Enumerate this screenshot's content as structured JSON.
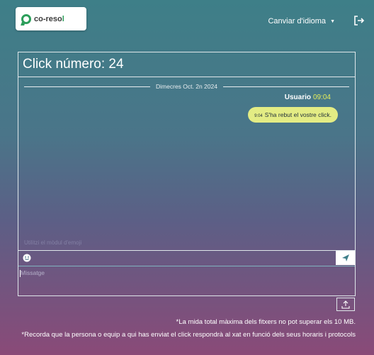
{
  "header": {
    "logo_text_prefix": "co-reso",
    "logo_text_suffix": "l",
    "language_label": "Canviar d'idioma",
    "language_caret": "▼"
  },
  "chat": {
    "title": "Click número: 24",
    "date_separator": "Dimecres Oct. 2n 2024",
    "messages": [
      {
        "sender": "Usuario",
        "time": "09:04",
        "bubble_time": "9:04",
        "text": "S'ha rebut el vostre click."
      }
    ],
    "emoji_hint": "Utilitzi el mòdul d'emoji",
    "message_placeholder": "Missatge"
  },
  "notes": {
    "size_limit": "*La mida total màxima dels fitxers no pot superar els 10 MB.",
    "response_info": "*Recorda que la persona o equip a qui has enviat el click respondrà al xat en funció dels seus horaris i protocols"
  },
  "colors": {
    "accent_green": "#2c9e5a",
    "bubble": "#e3ec84",
    "time_highlight": "#e6ef5a"
  },
  "icons": [
    "logout-icon",
    "emoji-icon",
    "send-icon",
    "upload-icon",
    "chevron-down-icon"
  ]
}
